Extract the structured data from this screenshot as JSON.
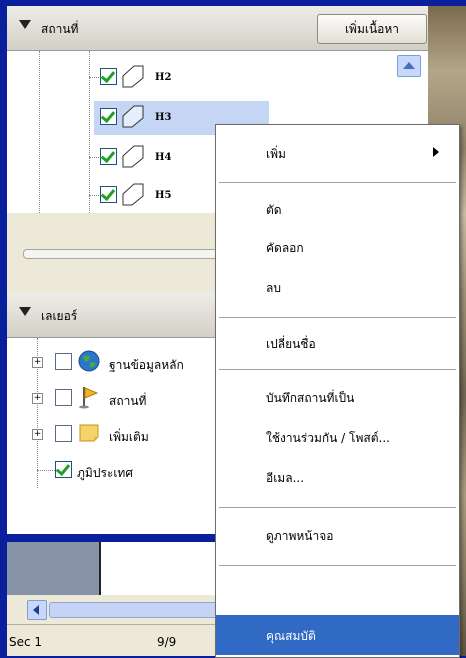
{
  "places_panel": {
    "title": "สถานที่",
    "search_button": "เพิ่มเนื้อหา",
    "items": [
      {
        "label": "H2",
        "checked": true,
        "selected": false
      },
      {
        "label": "H3",
        "checked": true,
        "selected": true
      },
      {
        "label": "H4",
        "checked": true,
        "selected": false
      },
      {
        "label": "H5",
        "checked": true,
        "selected": false
      }
    ]
  },
  "layers_panel": {
    "title": "เลเยอร์",
    "items": [
      {
        "label": "ฐานข้อมูลหลัก",
        "icon": "globe-icon",
        "expandable": true,
        "checked": false
      },
      {
        "label": "สถานที่",
        "icon": "flag-icon",
        "expandable": true,
        "checked": false
      },
      {
        "label": "เพิ่มเติม",
        "icon": "folder-icon",
        "expandable": true,
        "checked": false
      },
      {
        "label": "ภูมิประเทศ",
        "icon": "",
        "expandable": false,
        "checked": true
      }
    ]
  },
  "status_bar": {
    "left": "Sec 1",
    "right": "9/9"
  },
  "context_menu": {
    "items": [
      {
        "label": "เพิ่ม",
        "submenu": true
      },
      {
        "label": "ตัด"
      },
      {
        "label": "คัดลอก"
      },
      {
        "label": "ลบ"
      },
      {
        "label": "เปลี่ยนชื่อ"
      },
      {
        "label": "บันทึกสถานที่เป็น"
      },
      {
        "label": "ใช้งานร่วมกัน / โพสต์..."
      },
      {
        "label": "อีเมล..."
      },
      {
        "label": "ดูภาพหน้าจอ"
      },
      {
        "label": "คุณสมบัติ",
        "highlighted": true
      }
    ]
  },
  "colors": {
    "frame_blue": "#0a1f9c",
    "selection_blue": "#316ac5",
    "row_selection": "#c5d6f5",
    "checkbox_green": "#21a121"
  }
}
